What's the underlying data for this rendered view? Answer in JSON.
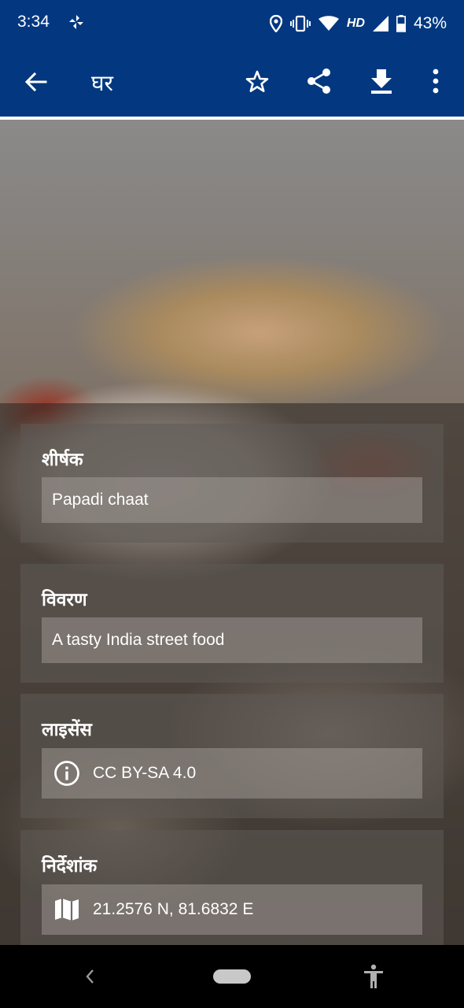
{
  "status_bar": {
    "time": "3:34",
    "network": "HD",
    "battery": "43%",
    "icons": [
      "pinwheel-icon",
      "location-icon",
      "vibrate-icon",
      "wifi-icon",
      "signal-icon",
      "battery-icon"
    ]
  },
  "app_bar": {
    "title": "घर",
    "icons": [
      "back-arrow-icon",
      "star-icon",
      "share-icon",
      "download-icon",
      "more-vert-icon"
    ]
  },
  "fields": {
    "title": {
      "label": "शीर्षक",
      "value": "Papadi chaat"
    },
    "description": {
      "label": "विवरण",
      "value": "A tasty India street food"
    },
    "license": {
      "label": "लाइसेंस",
      "value": "CC BY-SA 4.0",
      "icon": "info-icon"
    },
    "coordinates": {
      "label": "निर्देशांक",
      "value": "21.2576 N, 81.6832 E",
      "icon": "map-icon"
    }
  },
  "nav_bar": {
    "icons": [
      "nav-back-icon",
      "home-pill",
      "accessibility-icon"
    ]
  },
  "colors": {
    "primary": "#033880",
    "text_on_primary": "#ffffff",
    "nav_bar": "#000000"
  }
}
